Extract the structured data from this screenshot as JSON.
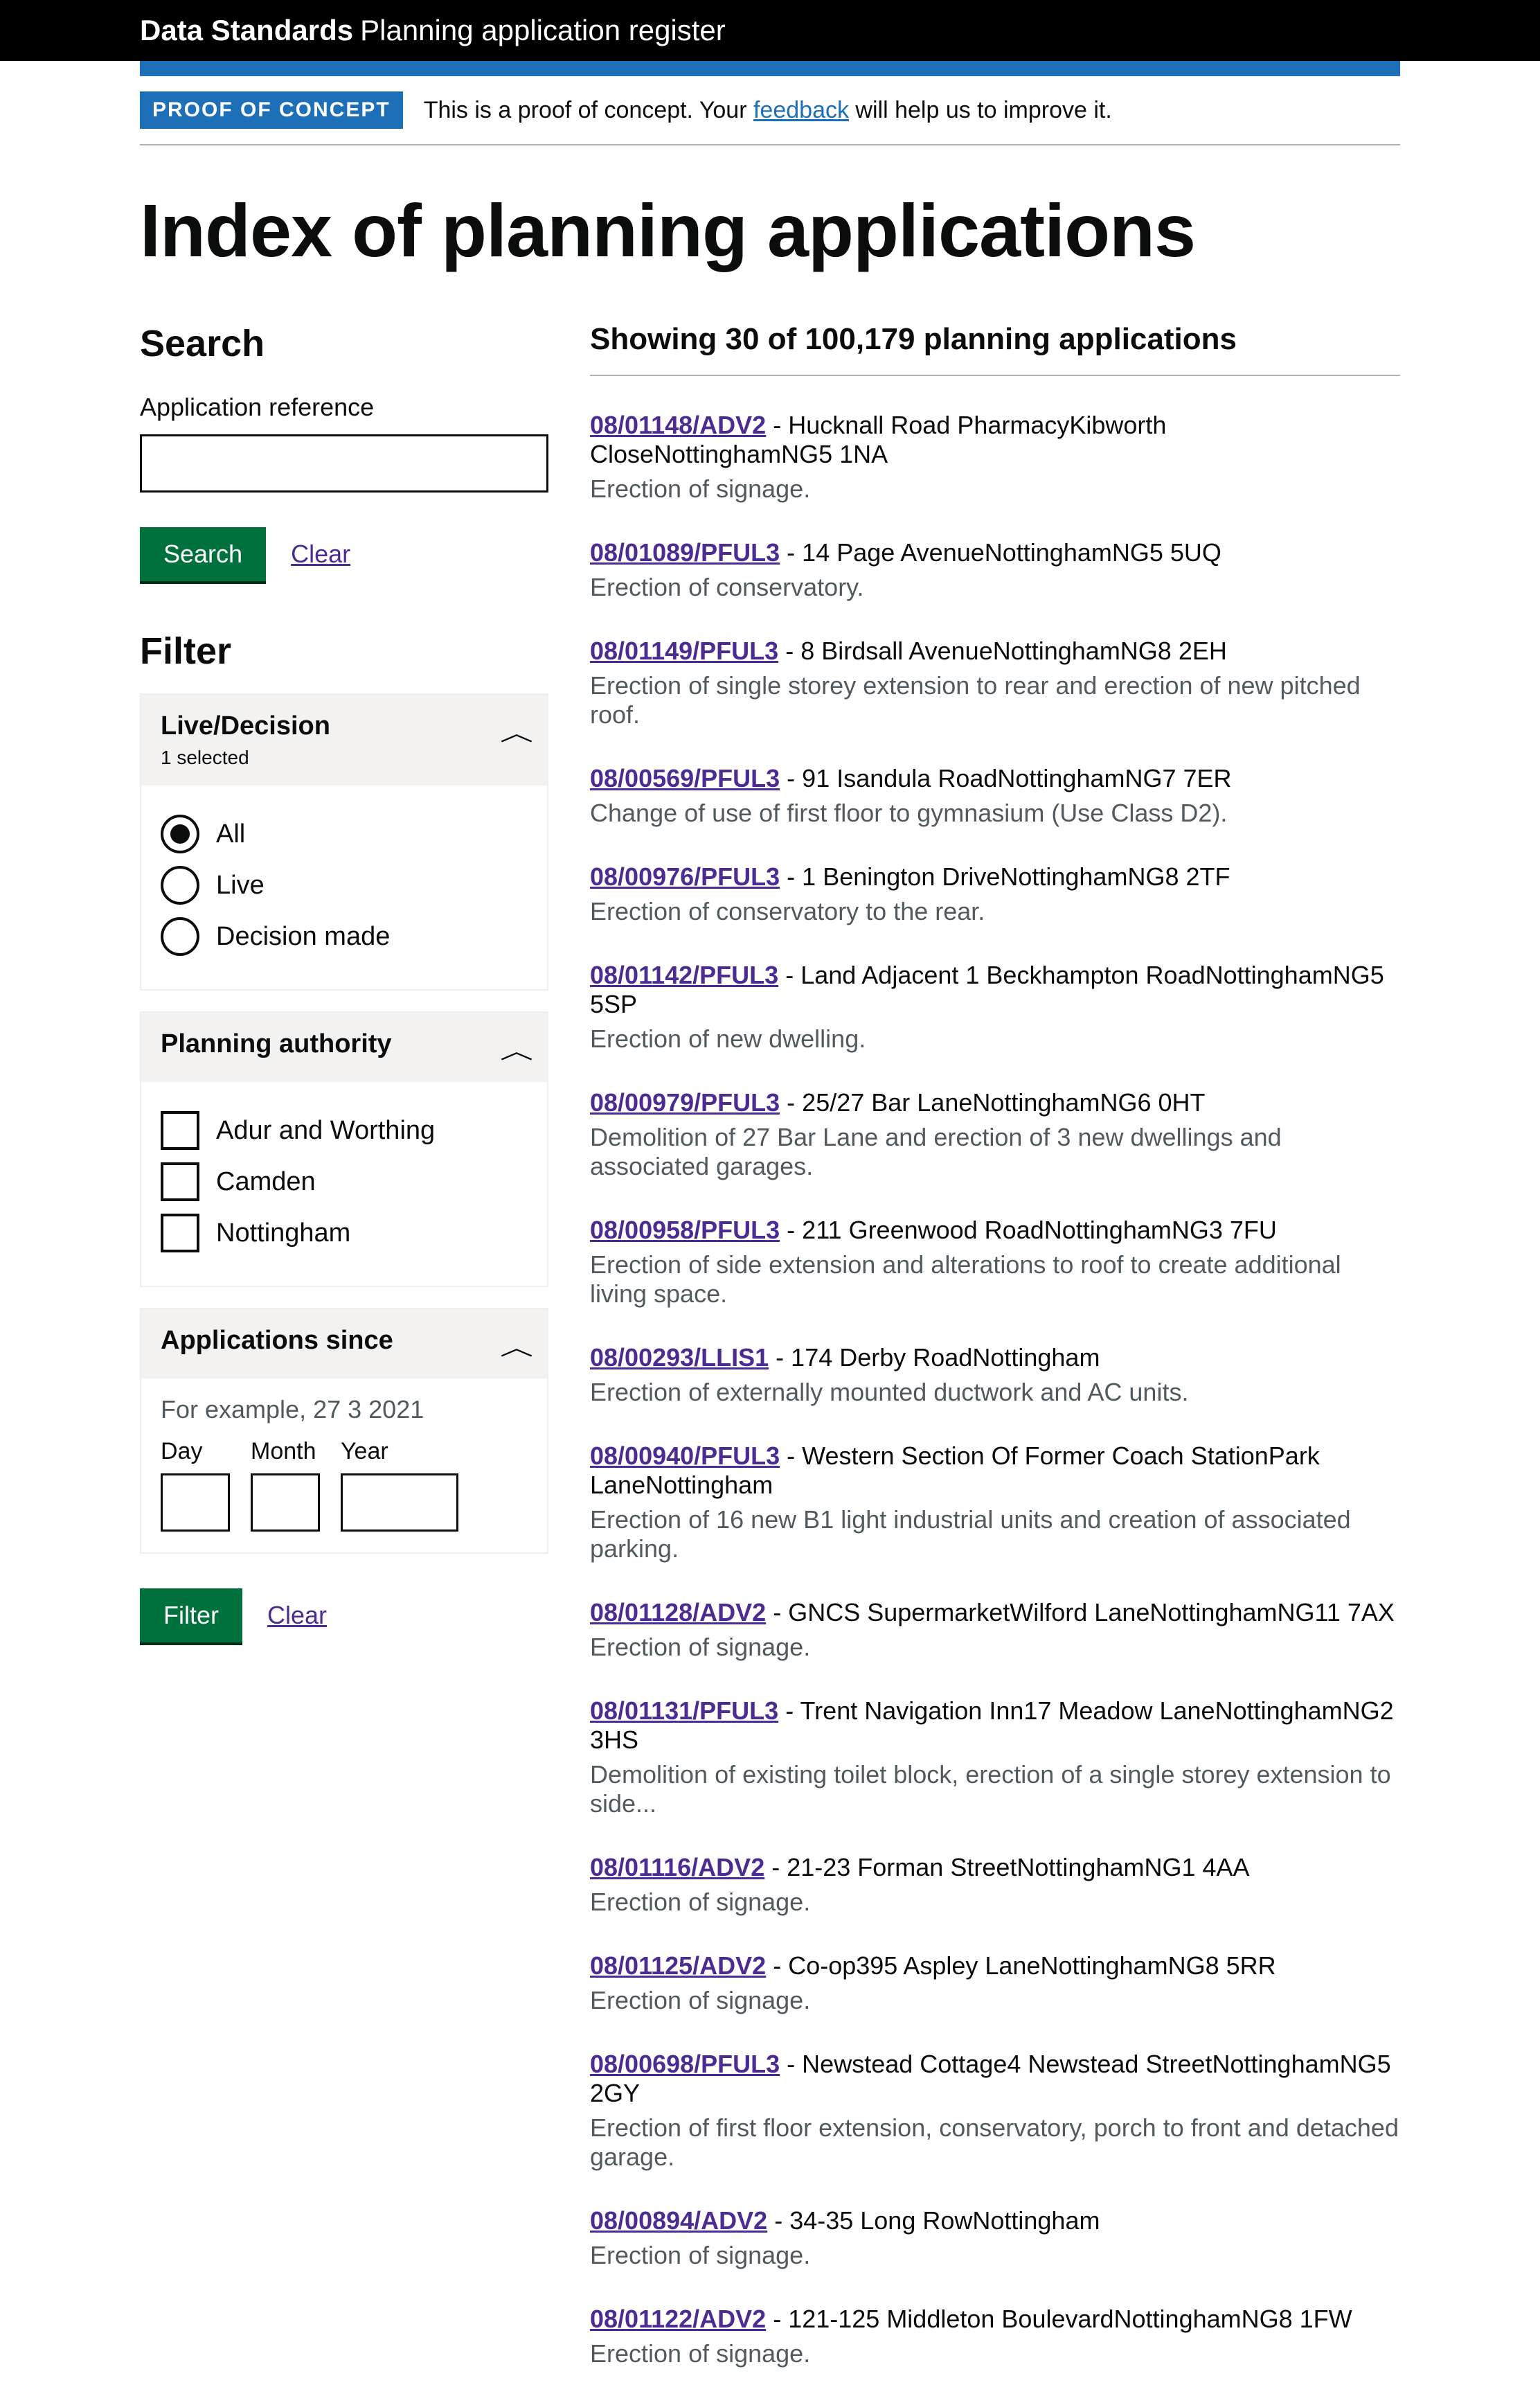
{
  "header": {
    "brand_bold": "Data Standards",
    "brand_light": "Planning application register"
  },
  "notice": {
    "badge": "PROOF OF CONCEPT",
    "prefix": "This is a proof of concept. Your ",
    "link": "feedback",
    "suffix": " will help us to improve it."
  },
  "page_title": "Index of planning applications",
  "search": {
    "heading": "Search",
    "label": "Application reference",
    "button": "Search",
    "clear": "Clear"
  },
  "filter": {
    "heading": "Filter",
    "button": "Filter",
    "clear": "Clear",
    "facets": {
      "live_decision": {
        "title": "Live/Decision",
        "subtitle": "1 selected",
        "options": {
          "all": "All",
          "live": "Live",
          "decided": "Decision made"
        }
      },
      "authority": {
        "title": "Planning authority",
        "options": {
          "adur": "Adur and Worthing",
          "camden": "Camden",
          "nottingham": "Nottingham"
        }
      },
      "since": {
        "title": "Applications since",
        "hint": "For example, 27 3 2021",
        "day": "Day",
        "month": "Month",
        "year": "Year"
      }
    }
  },
  "results": {
    "heading": "Showing 30 of 100,179 planning applications",
    "items": [
      {
        "ref": "08/01148/ADV2",
        "address": "Hucknall Road PharmacyKibworth CloseNottinghamNG5 1NA",
        "desc": "Erection of signage."
      },
      {
        "ref": "08/01089/PFUL3",
        "address": "14 Page AvenueNottinghamNG5 5UQ",
        "desc": "Erection of conservatory."
      },
      {
        "ref": "08/01149/PFUL3",
        "address": "8 Birdsall AvenueNottinghamNG8 2EH",
        "desc": "Erection of single storey extension to rear and erection of new pitched roof."
      },
      {
        "ref": "08/00569/PFUL3",
        "address": "91 Isandula RoadNottinghamNG7 7ER",
        "desc": "Change of use of first floor to gymnasium (Use Class D2)."
      },
      {
        "ref": "08/00976/PFUL3",
        "address": "1 Benington DriveNottinghamNG8 2TF",
        "desc": "Erection of conservatory to the rear."
      },
      {
        "ref": "08/01142/PFUL3",
        "address": "Land Adjacent 1 Beckhampton RoadNottinghamNG5 5SP",
        "desc": "Erection of new dwelling."
      },
      {
        "ref": "08/00979/PFUL3",
        "address": "25/27 Bar LaneNottinghamNG6 0HT",
        "desc": "Demolition of 27 Bar Lane and erection of 3 new dwellings and associated garages."
      },
      {
        "ref": "08/00958/PFUL3",
        "address": "211 Greenwood RoadNottinghamNG3 7FU",
        "desc": "Erection of side extension and alterations to roof to create additional living space."
      },
      {
        "ref": "08/00293/LLIS1",
        "address": "174 Derby RoadNottingham",
        "desc": "Erection of externally mounted ductwork and AC units."
      },
      {
        "ref": "08/00940/PFUL3",
        "address": "Western Section Of Former Coach StationPark LaneNottingham",
        "desc": "Erection of 16 new B1 light industrial units and creation of associated parking."
      },
      {
        "ref": "08/01128/ADV2",
        "address": "GNCS SupermarketWilford LaneNottinghamNG11 7AX",
        "desc": "Erection of signage."
      },
      {
        "ref": "08/01131/PFUL3",
        "address": "Trent Navigation Inn17 Meadow LaneNottinghamNG2 3HS",
        "desc": "Demolition of existing toilet block, erection of a single storey extension to side..."
      },
      {
        "ref": "08/01116/ADV2",
        "address": "21-23 Forman StreetNottinghamNG1 4AA",
        "desc": "Erection of signage."
      },
      {
        "ref": "08/01125/ADV2",
        "address": "Co-op395 Aspley LaneNottinghamNG8 5RR",
        "desc": "Erection of signage."
      },
      {
        "ref": "08/00698/PFUL3",
        "address": "Newstead Cottage4 Newstead StreetNottinghamNG5 2GY",
        "desc": "Erection of first floor extension, conservatory, porch to front and detached garage."
      },
      {
        "ref": "08/00894/ADV2",
        "address": "34-35 Long RowNottingham",
        "desc": "Erection of signage."
      },
      {
        "ref": "08/01122/ADV2",
        "address": "121-125 Middleton BoulevardNottinghamNG8 1FW",
        "desc": "Erection of signage."
      }
    ]
  }
}
